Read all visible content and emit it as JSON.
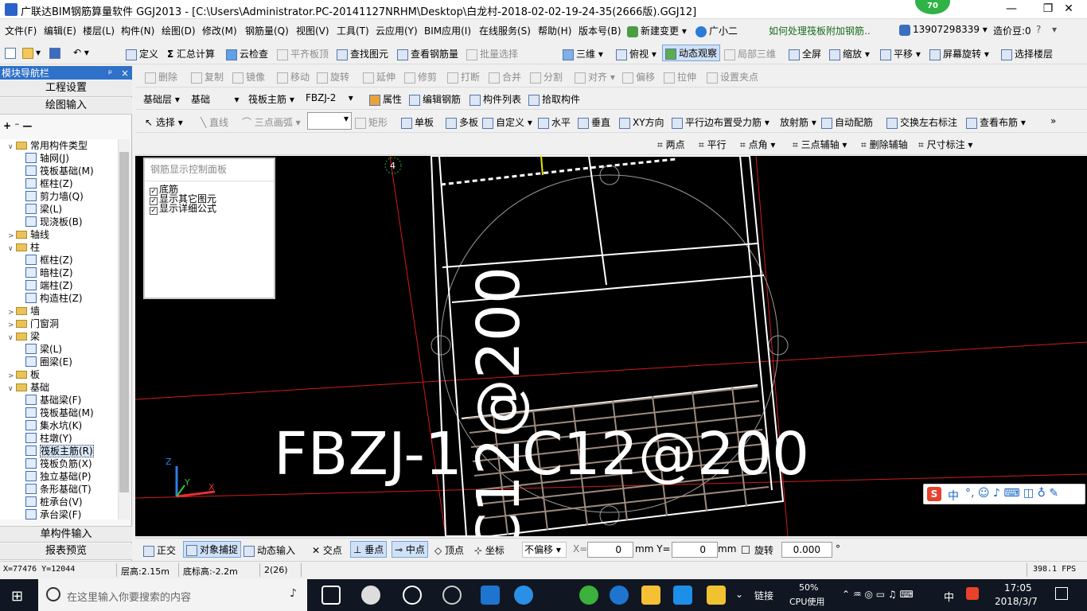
{
  "window": {
    "title": "广联达BIM钢筋算量软件 GGJ2013 - [C:\\Users\\Administrator.PC-20141127NRHM\\Desktop\\白龙村-2018-02-02-19-24-35(2666版).GGJ12]",
    "badge": "70",
    "minimize": "—",
    "restore": "❐",
    "close": "✕"
  },
  "menu": {
    "items": [
      "文件(F)",
      "编辑(E)",
      "楼层(L)",
      "构件(N)",
      "绘图(D)",
      "修改(M)",
      "钢筋量(Q)",
      "视图(V)",
      "工具(T)",
      "云应用(Y)",
      "BIM应用(I)",
      "在线服务(S)",
      "帮助(H)",
      "版本号(B)"
    ],
    "new_change": "新建变更",
    "assistant": "广小二",
    "question_link": "如何处理筏板附加钢筋..",
    "phone": "13907298339",
    "price_bean": "造价豆:0"
  },
  "toolbar1": {
    "define": "定义",
    "sum_calc": "汇总计算",
    "cloud_check": "云检查",
    "flat_top": "平齐板顶",
    "find_element": "查找图元",
    "view_rebar": "查看钢筋量",
    "batch_select": "批量选择",
    "three_d": "三维",
    "top_view": "俯视",
    "dynamic_view": "动态观察",
    "local_3d": "局部三维",
    "full_screen": "全屏",
    "zoom": "缩放",
    "pan": "平移",
    "screen_rotate": "屏幕旋转",
    "select_floor": "选择楼层"
  },
  "toolbar2": {
    "delete": "删除",
    "copy": "复制",
    "mirror": "镜像",
    "move": "移动",
    "rotate": "旋转",
    "extend": "延伸",
    "trim": "修剪",
    "break": "打断",
    "merge": "合并",
    "split": "分割",
    "align": "对齐",
    "offset": "偏移",
    "stretch": "拉伸",
    "set_vertex": "设置夹点"
  },
  "toolbar3": {
    "floor": "基础层",
    "category": "基础",
    "type": "筏板主筋",
    "name": "FBZJ-2",
    "properties": "属性",
    "edit_rebar": "编辑钢筋",
    "element_list": "构件列表",
    "pick_element": "拾取构件"
  },
  "toolbar4": {
    "select": "选择",
    "line": "直线",
    "arc": "三点画弧",
    "rect": "矩形",
    "single_board": "单板",
    "multi_board": "多板",
    "custom": "自定义",
    "horizontal": "水平",
    "vertical": "垂直",
    "xy_dir": "XY方向",
    "parallel_edge": "平行边布置受力筋",
    "radial": "放射筋",
    "auto_rebar": "自动配筋",
    "swap_labels": "交换左右标注",
    "view_layout": "查看布筋"
  },
  "toolbar5": {
    "two_points": "两点",
    "parallel": "平行",
    "point_angle": "点角",
    "three_point_axis": "三点辅轴",
    "delete_axis": "删除辅轴",
    "dimension": "尺寸标注"
  },
  "left_panel": {
    "header": "模块导航栏",
    "pin": "ᵖ",
    "close": "×",
    "project_settings": "工程设置",
    "drawing_input": "绘图输入",
    "single_input": "单构件输入",
    "report_preview": "报表预览",
    "tree": [
      {
        "label": "常用构件类型",
        "level": 1,
        "folder": true,
        "toggle": "∨"
      },
      {
        "label": "轴网(J)",
        "level": 2
      },
      {
        "label": "筏板基础(M)",
        "level": 2
      },
      {
        "label": "框柱(Z)",
        "level": 2
      },
      {
        "label": "剪力墙(Q)",
        "level": 2
      },
      {
        "label": "梁(L)",
        "level": 2
      },
      {
        "label": "现浇板(B)",
        "level": 2
      },
      {
        "label": "轴线",
        "level": 1,
        "folder": true,
        "toggle": ">"
      },
      {
        "label": "柱",
        "level": 1,
        "folder": true,
        "toggle": "∨"
      },
      {
        "label": "框柱(Z)",
        "level": 2
      },
      {
        "label": "暗柱(Z)",
        "level": 2
      },
      {
        "label": "端柱(Z)",
        "level": 2
      },
      {
        "label": "构造柱(Z)",
        "level": 2
      },
      {
        "label": "墙",
        "level": 1,
        "folder": true,
        "toggle": ">"
      },
      {
        "label": "门窗洞",
        "level": 1,
        "folder": true,
        "toggle": ">"
      },
      {
        "label": "梁",
        "level": 1,
        "folder": true,
        "toggle": "∨"
      },
      {
        "label": "梁(L)",
        "level": 2
      },
      {
        "label": "圈梁(E)",
        "level": 2
      },
      {
        "label": "板",
        "level": 1,
        "folder": true,
        "toggle": ">"
      },
      {
        "label": "基础",
        "level": 1,
        "folder": true,
        "toggle": "∨"
      },
      {
        "label": "基础梁(F)",
        "level": 2
      },
      {
        "label": "筏板基础(M)",
        "level": 2
      },
      {
        "label": "集水坑(K)",
        "level": 2
      },
      {
        "label": "柱墩(Y)",
        "level": 2
      },
      {
        "label": "筏板主筋(R)",
        "level": 2,
        "selected": true
      },
      {
        "label": "筏板负筋(X)",
        "level": 2
      },
      {
        "label": "独立基础(P)",
        "level": 2
      },
      {
        "label": "条形基础(T)",
        "level": 2
      },
      {
        "label": "桩承台(V)",
        "level": 2
      },
      {
        "label": "承台梁(F)",
        "level": 2
      }
    ]
  },
  "canvas": {
    "panel_title": "钢筋显示控制面板",
    "checks": [
      "底筋",
      "显示其它图元",
      "显示详细公式"
    ],
    "axis_label": "4",
    "text_big_h": "FBZJ-1",
    "text_rebar_h": "C12@200",
    "text_rebar_v": "C12@200",
    "axis_z": "Z",
    "axis_y": "Y",
    "axis_x": "X"
  },
  "snap_bar": {
    "ortho": "正交",
    "snap": "对象捕捉",
    "dyn_input": "动态输入",
    "intersect": "交点",
    "perp": "垂点",
    "midpoint": "中点",
    "vertex": "顶点",
    "coord": "坐标",
    "no_offset": "不偏移",
    "x_label": "X=",
    "x_value": "0",
    "y_label": "mm Y=",
    "y_value": "0",
    "mm": "mm",
    "rotate_label": "旋转",
    "rotate_value": "0.000",
    "degree": "°"
  },
  "status_bar": {
    "coords": "X=77476 Y=12044",
    "floor_height": "层高:2.15m",
    "base_height": "底标高:-2.2m",
    "count": "2(26)",
    "fps": "398.1 FPS"
  },
  "taskbar": {
    "search_placeholder": "在这里输入你要搜索的内容",
    "link": "链接",
    "cpu_percent": "50%",
    "cpu_label": "CPU使用",
    "ime": "中",
    "time": "17:05",
    "date": "2018/3/7"
  },
  "ime_bar": {
    "label": "中"
  }
}
